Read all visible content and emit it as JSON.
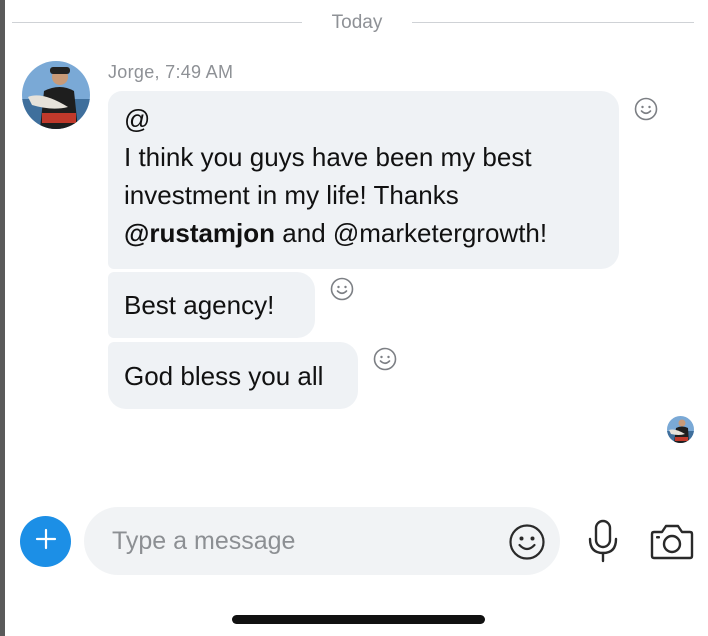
{
  "divider": {
    "label": "Today"
  },
  "message_group": {
    "sender": "Jorge",
    "time": "7:49 AM",
    "meta": "Jorge, 7:49 AM",
    "messages": [
      {
        "lines": [
          {
            "parts": [
              {
                "text": "@",
                "bold": false
              }
            ]
          },
          {
            "parts": [
              {
                "text": "I think you guys have been my best",
                "bold": false
              }
            ]
          },
          {
            "parts": [
              {
                "text": "investment in my life! Thanks",
                "bold": false
              }
            ]
          },
          {
            "parts": [
              {
                "text": "@rustamjon",
                "bold": true
              },
              {
                "text": " and @marketergrowth!",
                "bold": false
              }
            ]
          }
        ]
      },
      {
        "lines": [
          {
            "parts": [
              {
                "text": "Best agency!",
                "bold": false
              }
            ]
          }
        ]
      },
      {
        "lines": [
          {
            "parts": [
              {
                "text": "God bless you all",
                "bold": false
              }
            ]
          }
        ]
      }
    ]
  },
  "composer": {
    "placeholder": "Type a message"
  },
  "icons": {
    "add": "plus-icon",
    "emoji": "smiley-icon",
    "mic": "microphone-icon",
    "camera": "camera-icon",
    "reaction": "smiley-icon"
  },
  "colors": {
    "accent": "#1c8fe6",
    "bubble": "#eff2f5",
    "meta_text": "#8e9196"
  }
}
